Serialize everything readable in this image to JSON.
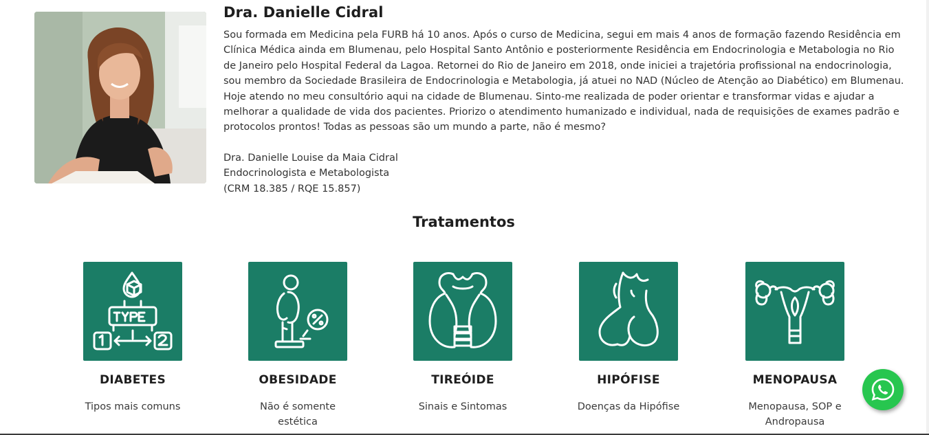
{
  "profile": {
    "name": "Dra. Danielle Cidral",
    "bio": "Sou formada em Medicina pela FURB há 10 anos. Após o curso de Medicina, segui em mais 4 anos de formação fazendo Residência em Clínica Médica ainda em Blumenau, pelo Hospital Santo Antônio e posteriormente Residência em Endocrinologia e Metabologia no Rio de Janeiro pelo Hospital Federal da Lagoa. Retornei do Rio de Janeiro em 2018, onde iniciei a trajetória profissional na endocrinologia, sou membro da Sociedade Brasileira de Endocrinologia e Metabologia, já atuei no NAD (Núcleo de Atenção ao Diabético) em Blumenau. Hoje atendo no meu consultório aqui na cidade de Blumenau. Sinto-me realizada de poder orientar e transformar vidas e ajudar a melhorar a qualidade de vida dos pacientes. Priorizo o atendimento humanizado e individual, nada de requisições de exames padrão e protocolos prontos! Todas as pessoas são um mundo a parte, não é mesmo?",
    "signature_name": "Dra. Danielle Louise da Maia Cidral",
    "signature_title": "Endocrinologista e Metabologista",
    "signature_registry": "(CRM 18.385 / RQE 15.857)"
  },
  "treatments": {
    "title": "Tratamentos",
    "items": [
      {
        "name": "DIABETES",
        "desc": "Tipos mais comuns",
        "icon": "diabetes-type-icon"
      },
      {
        "name": "OBESIDADE",
        "desc": "Não é somente estética",
        "icon": "scale-weight-icon"
      },
      {
        "name": "TIREÓIDE",
        "desc": "Sinais e Sintomas",
        "icon": "thyroid-icon"
      },
      {
        "name": "HIPÓFISE",
        "desc": "Doenças da Hipófise",
        "icon": "pituitary-icon"
      },
      {
        "name": "MENOPAUSA",
        "desc": "Menopausa, SOP e Andropausa",
        "icon": "uterus-icon"
      }
    ]
  },
  "colors": {
    "tile_green": "#1b7d66",
    "whatsapp_green": "#27c64f"
  },
  "whatsapp": {
    "icon": "whatsapp-icon"
  }
}
